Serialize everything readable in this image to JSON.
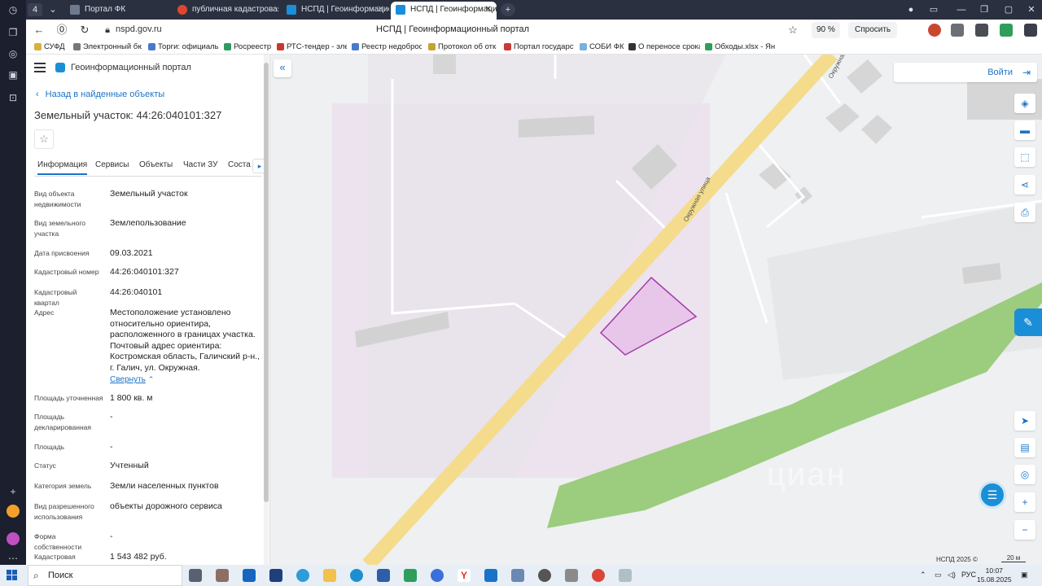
{
  "browser": {
    "tabs": [
      {
        "label": "Портал ФК"
      },
      {
        "label": "публичная кадастровая к"
      },
      {
        "label": "НСПД | Геоинформацио"
      },
      {
        "label": "НСПД | Геоинформацио"
      }
    ],
    "tab_counter": "4",
    "url": "nspd.gov.ru",
    "page_title": "НСПД | Геоинформационный портал",
    "zoom": "90 %",
    "ask_label": "Спросить",
    "bookmarks": [
      {
        "label": "СУФД"
      },
      {
        "label": "Электронный бю"
      },
      {
        "label": "Торги: официаль"
      },
      {
        "label": "Росреестр"
      },
      {
        "label": "РТС-тендер - элек"
      },
      {
        "label": "Реестр недобросо"
      },
      {
        "label": "Протокол об отка"
      },
      {
        "label": "Портал государст"
      },
      {
        "label": "СОБИ ФК"
      },
      {
        "label": "О переносе срока"
      },
      {
        "label": "Обходы.xlsx - Янд"
      }
    ]
  },
  "panel": {
    "portal_name": "Геоинформационный портал",
    "back_label": "Назад в найденные объекты",
    "title": "Земельный участок: 44:26:040101:327",
    "tabs": [
      {
        "label": "Информация"
      },
      {
        "label": "Сервисы"
      },
      {
        "label": "Объекты"
      },
      {
        "label": "Части ЗУ"
      },
      {
        "label": "Соста"
      }
    ],
    "attributes": [
      {
        "label": "Вид объекта недвижимости",
        "value": "Земельный участок"
      },
      {
        "label": "Вид земельного участка",
        "value": "Землепользование"
      },
      {
        "label": "Дата присвоения",
        "value": "09.03.2021"
      },
      {
        "label": "Кадастровый номер",
        "value": "44:26:040101:327"
      },
      {
        "label": "Кадастровый квартал",
        "value": "44:26:040101"
      },
      {
        "label": "Адрес",
        "value": "Местоположение установлено относительно ориентира, расположенного в границах участка. Почтовый адрес ориентира: Костромская область, Галичский р-н., г. Галич, ул. Окружная."
      },
      {
        "label": "Площадь уточненная",
        "value": "1 800 кв. м"
      },
      {
        "label": "Площадь декларированная",
        "value": "-"
      },
      {
        "label": "Площадь",
        "value": "-"
      },
      {
        "label": "Статус",
        "value": "Учтенный"
      },
      {
        "label": "Категория земель",
        "value": "Земли населенных пунктов"
      },
      {
        "label": "Вид разрешенного использования",
        "value": "объекты дорожного сервиса"
      },
      {
        "label": "Форма собственности",
        "value": "-"
      },
      {
        "label": "Кадастровая",
        "value": "1 543 482 руб."
      }
    ],
    "collapse_label": "Свернуть"
  },
  "map": {
    "login_label": "Войти",
    "street_label_1": "Окружная ул",
    "street_label_2": "Окружная улица",
    "copyright": "НСПД 2025 ©",
    "scale": "20 м",
    "watermark": "циан",
    "parcel_color": "#e8c6ea",
    "road_color": "#f4dc8c",
    "green_color": "#9ccc7e"
  },
  "taskbar": {
    "search_label": "Поиск",
    "lang": "РУС",
    "time": "10:07",
    "date": "15.08.2025"
  }
}
